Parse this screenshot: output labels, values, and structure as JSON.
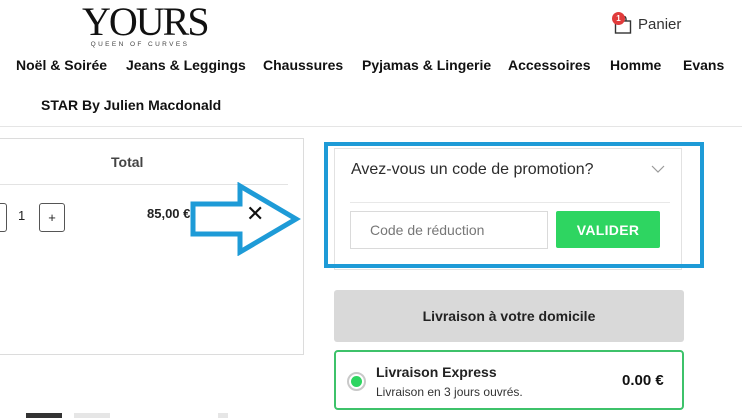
{
  "brand": {
    "logo_text": "YOURS",
    "logo_tagline": "QUEEN OF CURVES"
  },
  "cart": {
    "badge_count": "1",
    "label": "Panier"
  },
  "nav": {
    "items": [
      {
        "label": "Noël & Soirée"
      },
      {
        "label": "Jeans & Leggings"
      },
      {
        "label": "Chaussures"
      },
      {
        "label": "Pyjamas & Lingerie"
      },
      {
        "label": "Accessoires"
      },
      {
        "label": "Homme"
      },
      {
        "label": "Evans"
      },
      {
        "label": "STAR By Julien Macdonald"
      }
    ]
  },
  "cart_table": {
    "column_total": "Total",
    "row": {
      "quantity": "1",
      "plus_label": "+",
      "price": "85,00 €",
      "remove_label": "✕"
    }
  },
  "promo": {
    "title": "Avez-vous un code de promotion?",
    "input_placeholder": "Code de réduction",
    "input_value": "",
    "button_label": "VALIDER"
  },
  "delivery": {
    "header": "Livraison à votre domicile",
    "option": {
      "name": "Livraison Express",
      "description": "Livraison en 3 jours ouvrés.",
      "price": "0.00 €",
      "selected": true
    }
  },
  "colors": {
    "accent_green": "#2ed561",
    "highlight_blue": "#1e9bd7",
    "badge_red": "#e03b3b"
  },
  "icons": {
    "cart": "shopping-bag-icon",
    "chevron": "chevron-down-icon",
    "arrow": "right-arrow-outline-icon",
    "remove": "close-icon"
  }
}
